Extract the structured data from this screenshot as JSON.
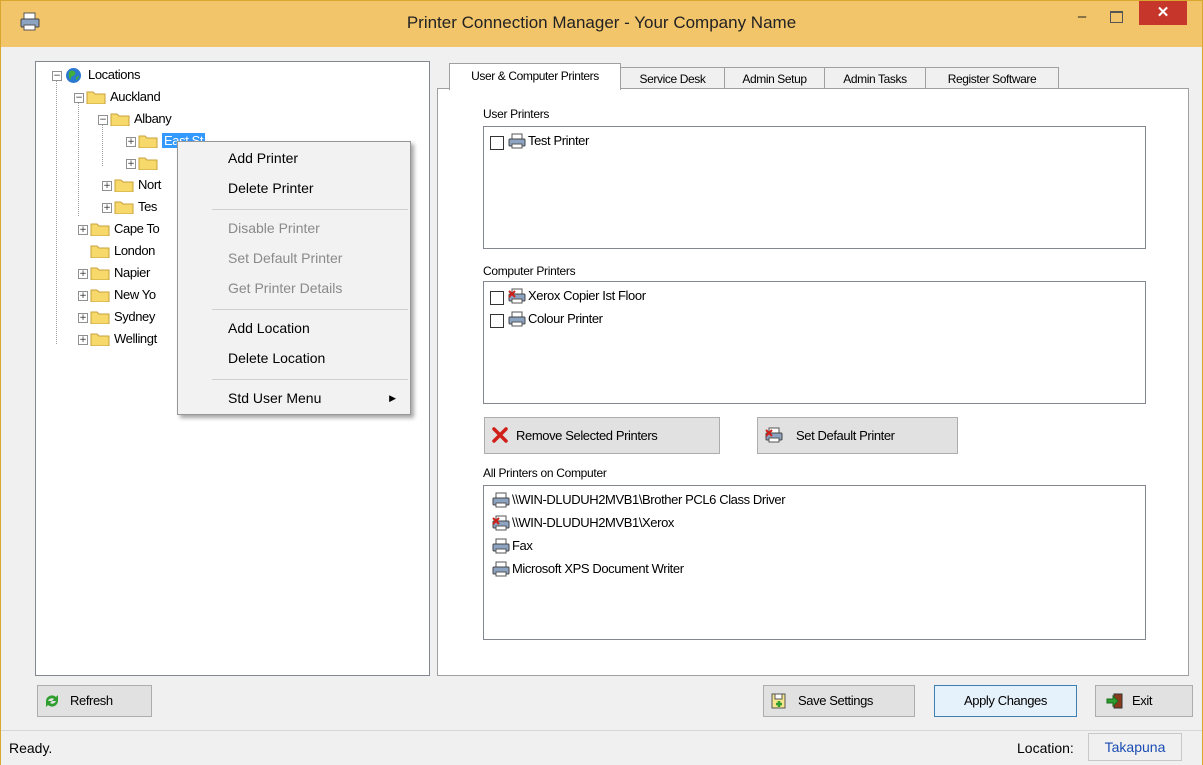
{
  "window": {
    "title": "Printer Connection Manager - Your Company Name"
  },
  "tree": {
    "root": "Locations",
    "nodes": [
      {
        "label": "Auckland"
      },
      {
        "label": "Albany"
      },
      {
        "label": "East St"
      },
      {
        "label": ""
      },
      {
        "label": "Nort"
      },
      {
        "label": "Tes"
      },
      {
        "label": "Cape To"
      },
      {
        "label": "London"
      },
      {
        "label": "Napier"
      },
      {
        "label": "New Yo"
      },
      {
        "label": "Sydney"
      },
      {
        "label": "Wellingt"
      }
    ]
  },
  "context_menu": {
    "items": [
      {
        "label": "Add Printer",
        "enabled": true
      },
      {
        "label": "Delete Printer",
        "enabled": true
      },
      {
        "label": "Disable Printer",
        "enabled": false
      },
      {
        "label": "Set Default Printer",
        "enabled": false
      },
      {
        "label": "Get Printer Details",
        "enabled": false
      },
      {
        "label": "Add Location",
        "enabled": true
      },
      {
        "label": "Delete Location",
        "enabled": true
      },
      {
        "label": "Std User Menu",
        "enabled": true,
        "submenu": true
      }
    ]
  },
  "tabs": [
    "User & Computer Printers",
    "Service Desk",
    "Admin Setup",
    "Admin Tasks",
    "Register Software"
  ],
  "user_printers": {
    "label": "User Printers",
    "items": [
      {
        "name": "Test Printer",
        "checked": false
      }
    ]
  },
  "computer_printers": {
    "label": "Computer Printers",
    "items": [
      {
        "name": "Xerox Copier Ist Floor",
        "checked": false,
        "icon": "printer-default-icon"
      },
      {
        "name": "Colour Printer",
        "checked": false,
        "icon": "printer-icon"
      }
    ]
  },
  "buttons": {
    "remove": "Remove Selected Printers",
    "set_default": "Set Default Printer",
    "refresh": "Refresh",
    "save": "Save Settings",
    "apply": "Apply Changes",
    "exit": "Exit"
  },
  "all_printers": {
    "label": "All Printers on Computer",
    "items": [
      {
        "name": "\\\\WIN-DLUDUH2MVB1\\Brother PCL6 Class Driver",
        "icon": "printer-icon"
      },
      {
        "name": "\\\\WIN-DLUDUH2MVB1\\Xerox",
        "icon": "printer-default-icon"
      },
      {
        "name": "Fax",
        "icon": "printer-icon"
      },
      {
        "name": "Microsoft XPS Document Writer",
        "icon": "printer-icon"
      }
    ]
  },
  "status": {
    "text": "Ready.",
    "location_label": "Location:",
    "location_value": "Takapuna"
  },
  "colors": {
    "titlebar": "#f3c56b",
    "close_button": "#c7362a",
    "selection": "#3399ff",
    "location_text": "#1a4db3"
  }
}
